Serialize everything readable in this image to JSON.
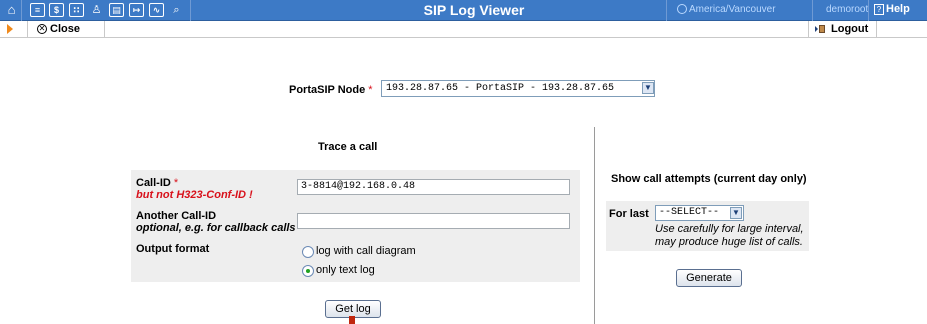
{
  "header": {
    "title": "SIP Log Viewer",
    "timezone": "America/Vancouver",
    "user": "demoroot",
    "help_label": "Help",
    "icons": [
      "home-icon",
      "list-icon",
      "dollar-icon",
      "grid-icon",
      "person-icon",
      "pbx-icon",
      "transfer-icon",
      "chart-icon",
      "search-icon"
    ]
  },
  "toolbar": {
    "close_label": "Close",
    "logout_label": "Logout"
  },
  "node": {
    "label": "PortaSIP Node",
    "required_mark": "*",
    "selected": "193.28.87.65 - PortaSIP - 193.28.87.65"
  },
  "trace": {
    "title": "Trace a call",
    "call_id_label": "Call-ID",
    "required_mark": "*",
    "call_id_note": "but not H323-Conf-ID !",
    "call_id_value": "3-8814@192.168.0.48",
    "another_label": "Another Call-ID",
    "another_note": "optional, e.g. for callback calls",
    "another_value": "",
    "format_label": "Output format",
    "options": [
      {
        "label": "log with call diagram",
        "selected": false
      },
      {
        "label": "only text log",
        "selected": true
      }
    ],
    "submit_label": "Get log"
  },
  "attempts": {
    "title": "Show call attempts (current day only)",
    "for_last_label": "For last",
    "select_value": "--SELECT--",
    "hint_line1": "Use carefully for large interval,",
    "hint_line2": "may produce huge list of calls.",
    "generate_label": "Generate"
  },
  "colors": {
    "header_bg": "#3d7ac6",
    "required": "#d8101a",
    "panel_bg": "#eeeeee",
    "play_orange": "#f08a1c"
  }
}
